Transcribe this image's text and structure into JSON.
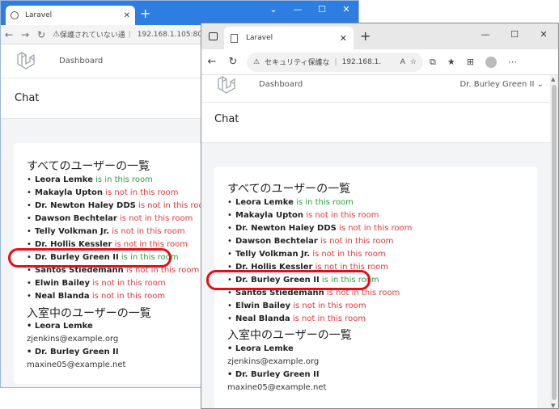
{
  "back_browser": {
    "tab_title": "Laravel",
    "address_warning": "保護されていない通",
    "address_url": "192.168.1.105:80"
  },
  "front_browser": {
    "tab_title": "Laravel",
    "address_warning": "セキュリティ保護な",
    "address_url": "192.168.1."
  },
  "nav": {
    "dashboard": "Dashboard",
    "user_menu": "Dr. Burley Green II"
  },
  "page": {
    "title": "Chat"
  },
  "users_heading": "すべてのユーザーの一覧",
  "users": [
    {
      "name": "Leora Lemke",
      "status": "is in this room",
      "in_room": true
    },
    {
      "name": "Makayla Upton",
      "status": "is not in this room",
      "in_room": false
    },
    {
      "name": "Dr. Newton Haley DDS",
      "status": "is not in this room",
      "in_room": false
    },
    {
      "name": "Dawson Bechtelar",
      "status": "is not in this room",
      "in_room": false
    },
    {
      "name": "Telly Volkman Jr.",
      "status": "is not in this room",
      "in_room": false
    },
    {
      "name": "Dr. Hollis Kessler",
      "status": "is not in this room",
      "in_room": false
    },
    {
      "name": "Dr. Burley Green II",
      "status": "is in this room",
      "in_room": true
    },
    {
      "name": "Santos Stiedemann",
      "status": "is not in this room",
      "in_room": false
    },
    {
      "name": "Elwin Bailey",
      "status": "is not in this room",
      "in_room": false
    },
    {
      "name": "Neal Blanda",
      "status": "is not in this room",
      "in_room": false
    }
  ],
  "members_heading": "入室中のユーザーの一覧",
  "members": [
    {
      "name": "Leora Lemke",
      "email": "zjenkins@example.org"
    },
    {
      "name": "Dr. Burley Green II",
      "email": "maxine05@example.net"
    }
  ],
  "colors": {
    "in_room": "#2f9e44",
    "not_in_room": "#e5383b",
    "highlight": "#e0101a"
  }
}
